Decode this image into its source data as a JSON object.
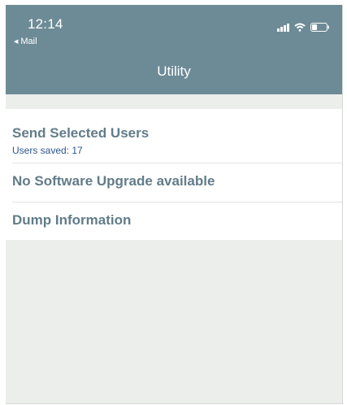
{
  "status_bar": {
    "time": "12:14",
    "back_app": "Mail"
  },
  "icons": {
    "signal": "cellular-signal-icon",
    "wifi": "wifi-icon",
    "battery": "battery-icon",
    "back": "back-arrow-icon"
  },
  "navbar": {
    "title": "Utility",
    "color": "#6d8b97"
  },
  "list": {
    "items": [
      {
        "title": "Send Selected Users",
        "subtitle": "Users saved: 17"
      },
      {
        "title": "No Software Upgrade available"
      },
      {
        "title": "Dump Information"
      }
    ]
  },
  "colors": {
    "row_title": "#627c89",
    "subtitle": "#2c5590",
    "background": "#eceeec"
  }
}
